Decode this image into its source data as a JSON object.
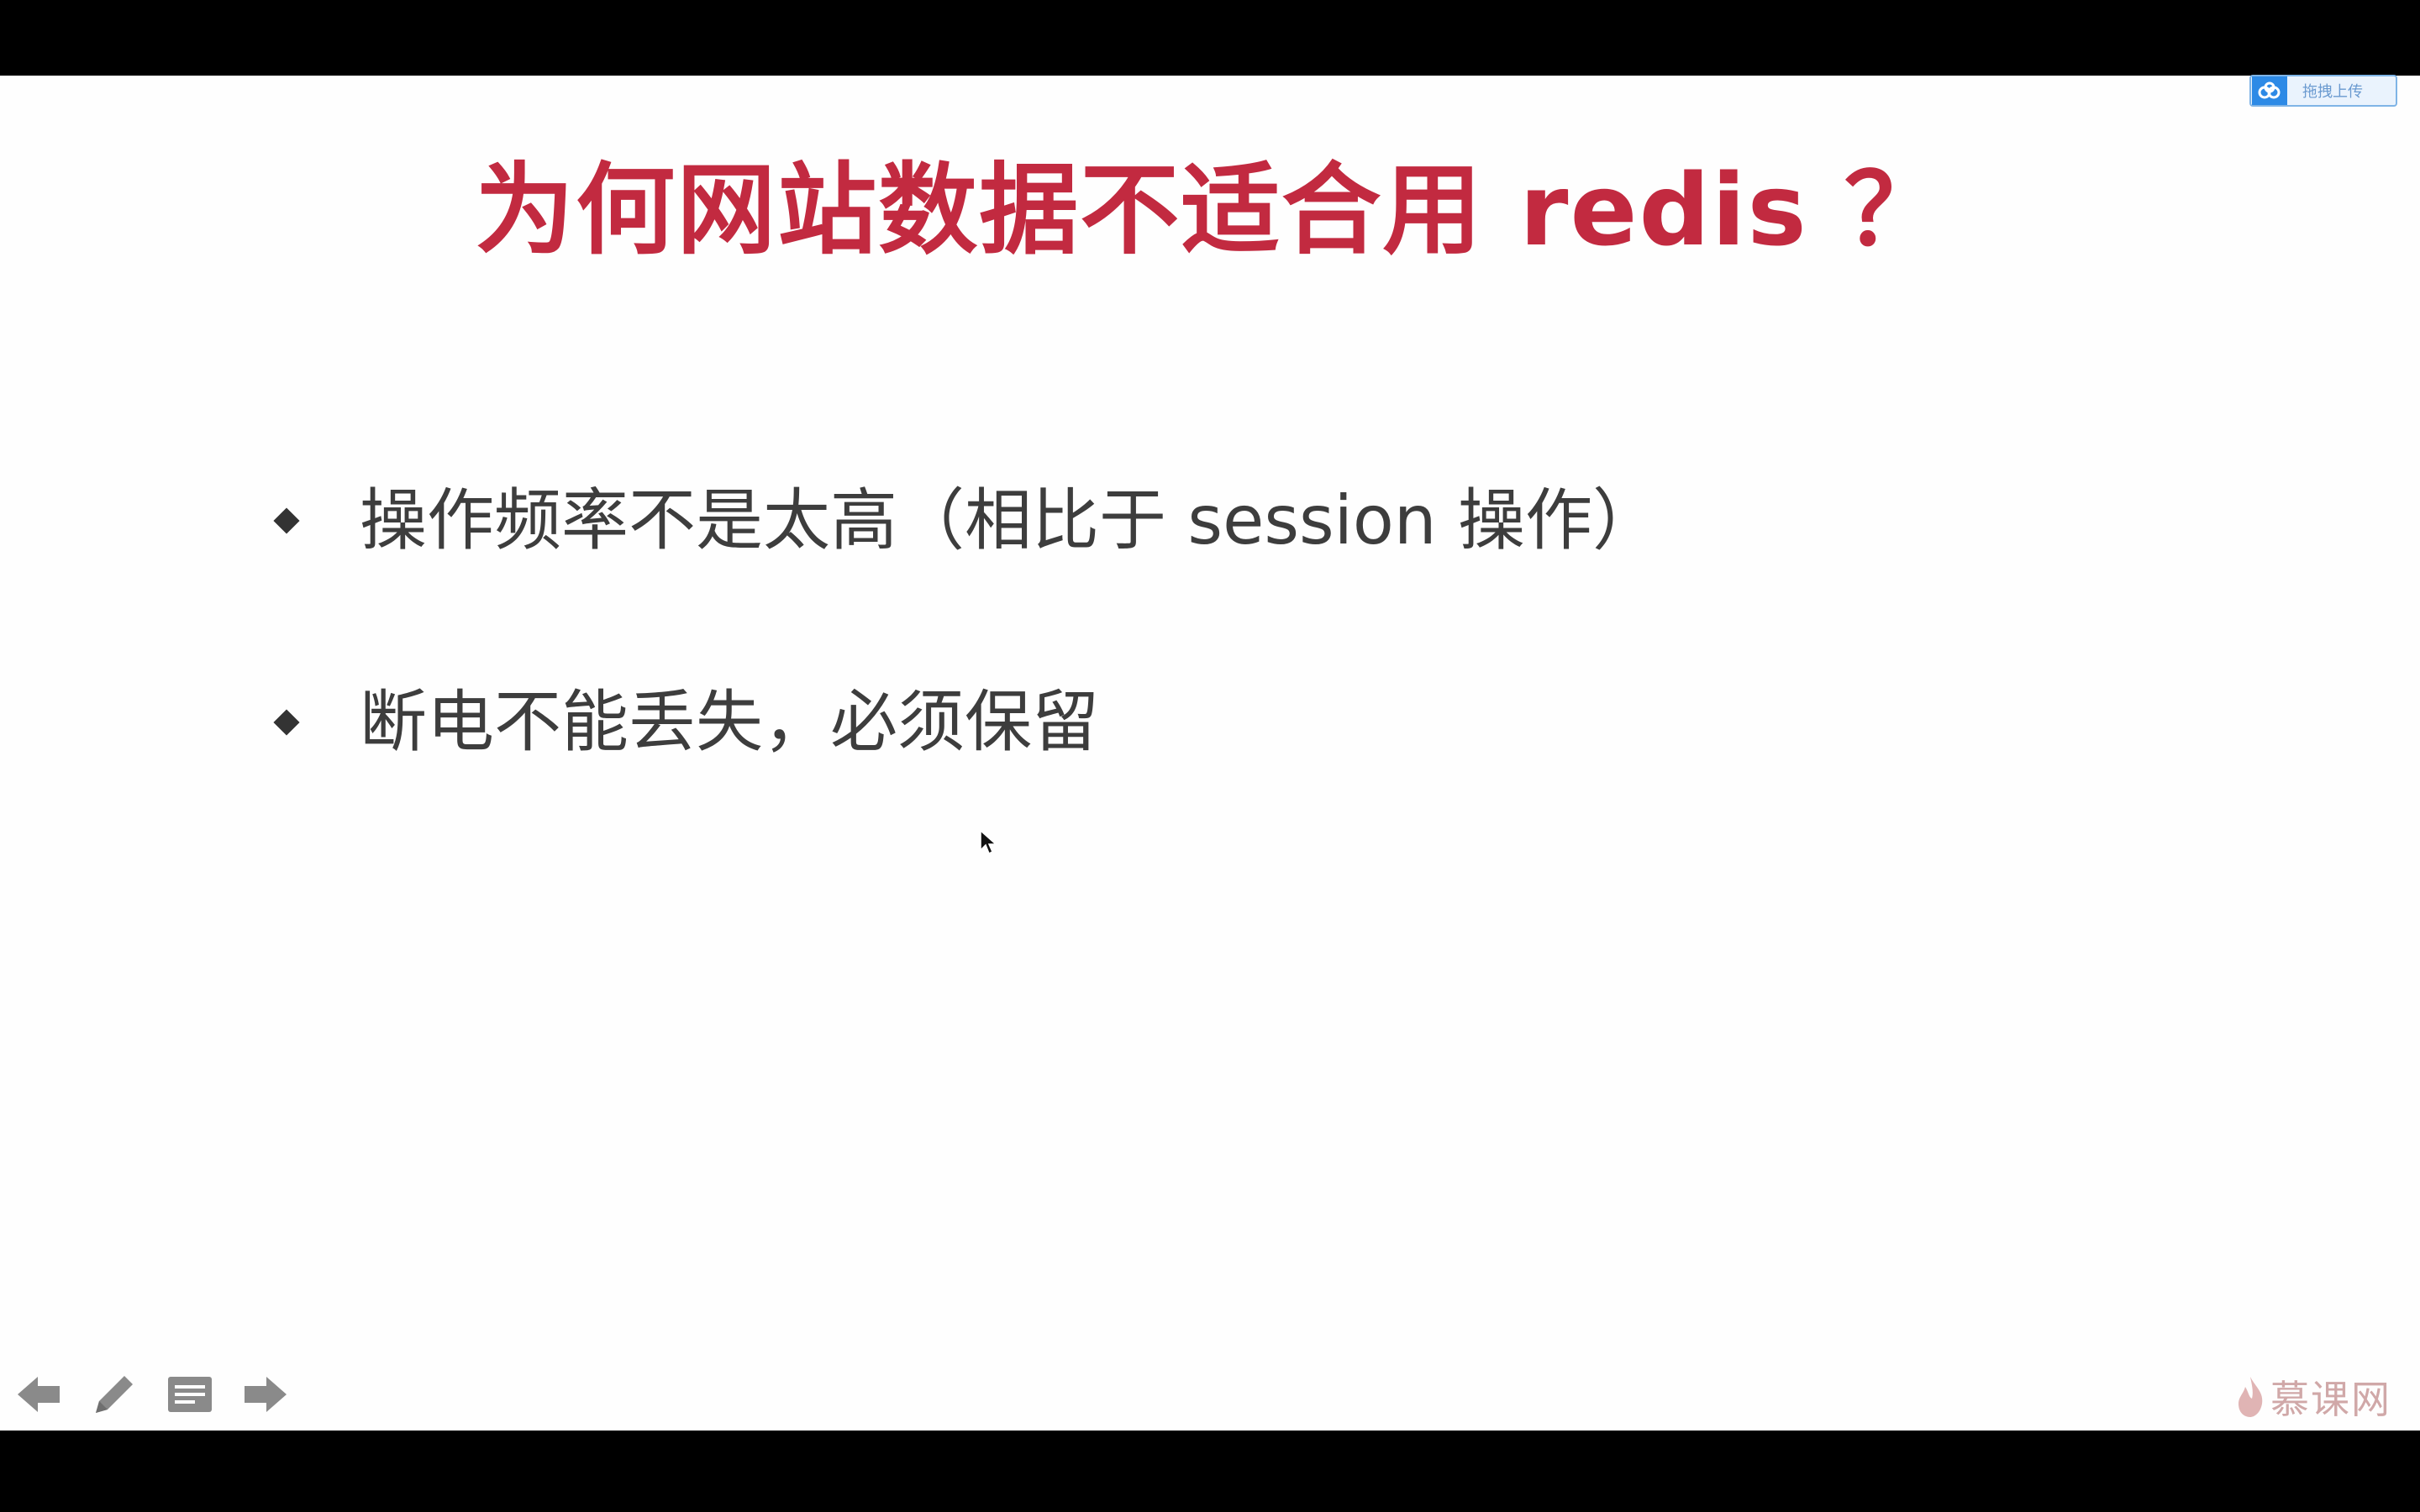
{
  "slide": {
    "title": "为何网站数据不适合用 redis ？",
    "bullets": [
      "操作频率不是太高（相比于 session 操作）",
      "断电不能丢失，必须保留"
    ]
  },
  "upload_badge": {
    "label": "拖拽上传",
    "icon": "cloud-icon"
  },
  "toolbar": {
    "icons": [
      "arrow-left-icon",
      "pencil-icon",
      "notes-icon",
      "arrow-right-icon"
    ]
  },
  "brand": {
    "name": "慕课网",
    "icon": "flame-icon"
  },
  "colors": {
    "title": "#c22a40",
    "bullet_text": "#3d3d3d",
    "toolbar_icon": "#8a8a8a"
  }
}
